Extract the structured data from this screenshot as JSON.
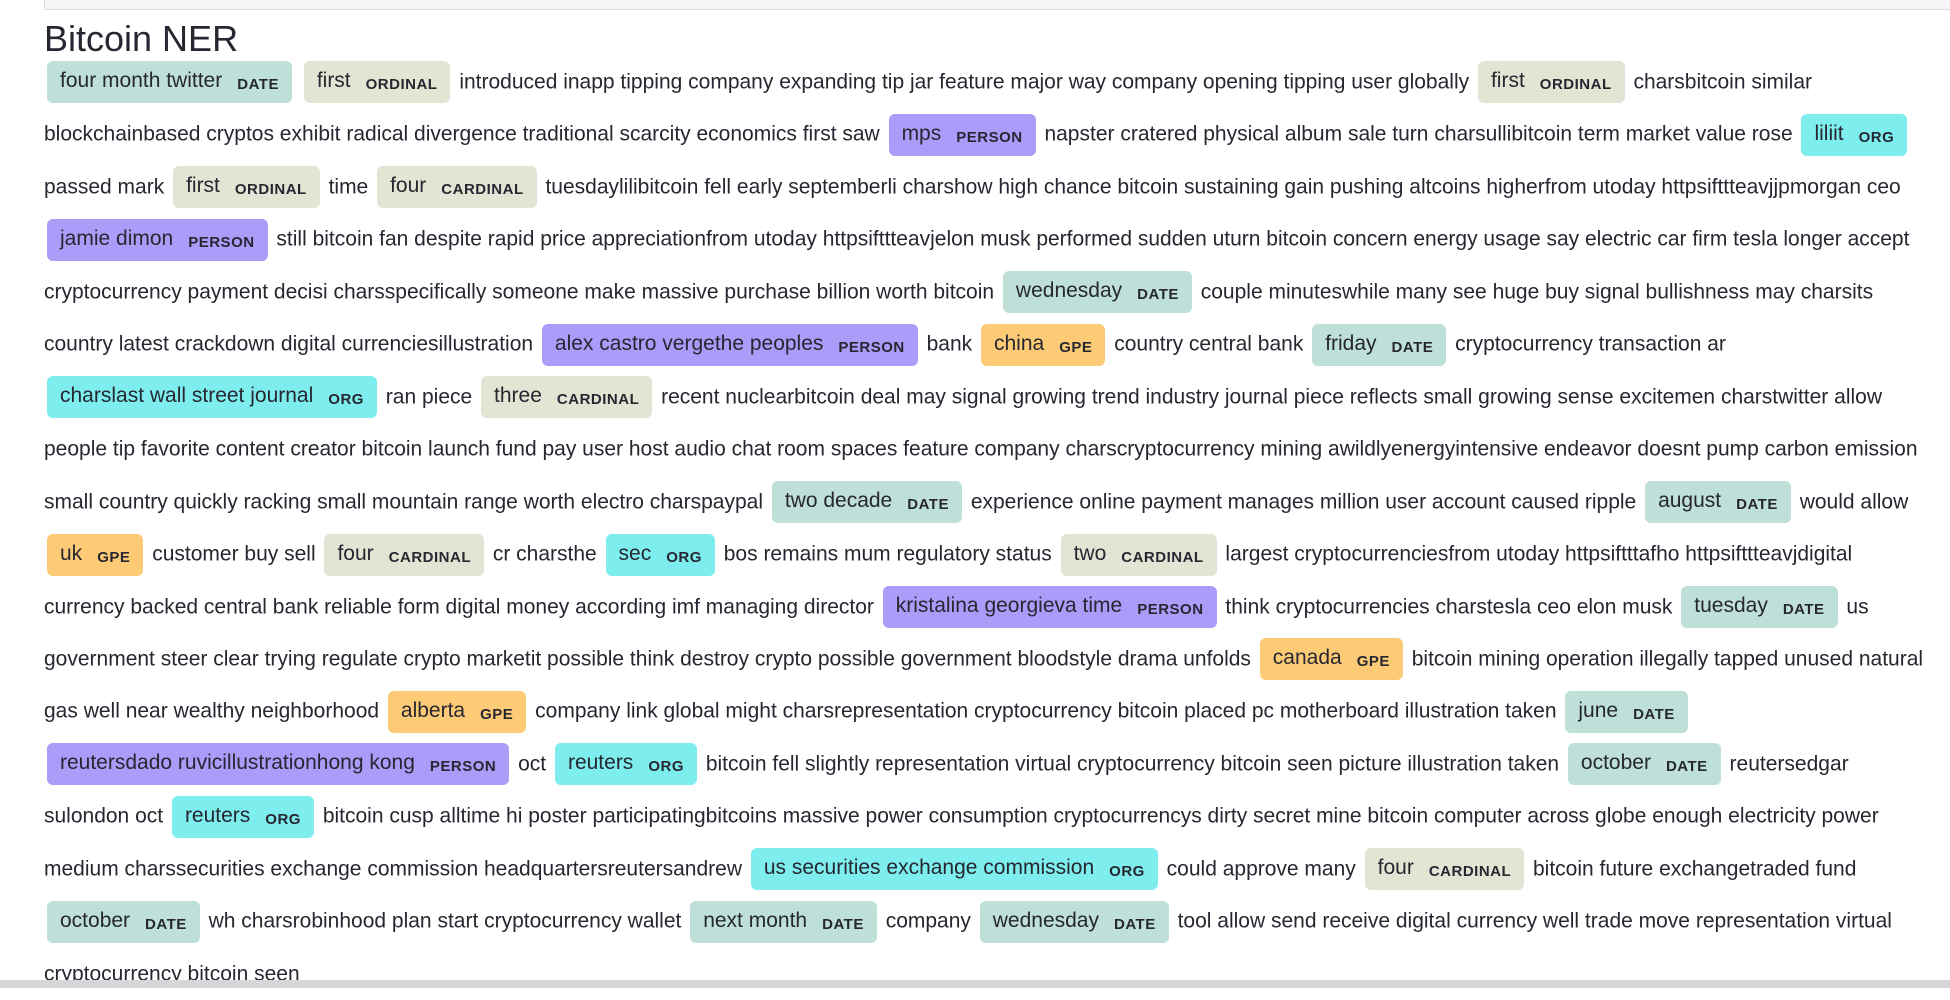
{
  "app": {
    "title": "Bitcoin NER"
  },
  "colors": {
    "DATE": "#bfe0d8",
    "ORDINAL": "#e2e5d4",
    "CARDINAL": "#e2e5d4",
    "PERSON": "#aa9cf9",
    "ORG": "#7deded",
    "GPE": "#fdcb76",
    "text": "#262730"
  },
  "ner": {
    "tokens": [
      {
        "label": "DATE",
        "text": "four month twitter"
      },
      {
        "label": "ORDINAL",
        "text": "first"
      },
      {
        "text": "introduced inapp tipping company expanding tip jar feature major way company opening tipping user globally"
      },
      {
        "label": "ORDINAL",
        "text": "first"
      },
      {
        "text": "charsbitcoin similar blockchainbased cryptos exhibit radical divergence traditional scarcity economics first saw"
      },
      {
        "label": "PERSON",
        "text": "mps"
      },
      {
        "text": "napster cratered physical album sale turn charsullibitcoin term market value rose"
      },
      {
        "label": "ORG",
        "text": "liliit"
      },
      {
        "text": "passed mark"
      },
      {
        "label": "ORDINAL",
        "text": "first"
      },
      {
        "text": "time"
      },
      {
        "label": "CARDINAL",
        "text": "four"
      },
      {
        "text": "tuesdaylilibitcoin fell early septemberli charshow high chance bitcoin sustaining gain pushing altcoins higherfrom utoday httpsifttteavjjpmorgan ceo"
      },
      {
        "label": "PERSON",
        "text": "jamie dimon"
      },
      {
        "text": "still bitcoin fan despite rapid price appreciationfrom utoday httpsifttteavjelon musk performed sudden uturn bitcoin concern energy usage say electric car firm tesla longer accept cryptocurrency payment decisi charsspecifically someone make massive purchase billion worth bitcoin"
      },
      {
        "label": "DATE",
        "text": "wednesday"
      },
      {
        "text": "couple minuteswhile many see huge buy signal bullishness may charsits country latest crackdown digital currenciesillustration"
      },
      {
        "label": "PERSON",
        "text": "alex castro vergethe peoples"
      },
      {
        "text": "bank"
      },
      {
        "label": "GPE",
        "text": "china"
      },
      {
        "text": "country central bank"
      },
      {
        "label": "DATE",
        "text": "friday"
      },
      {
        "text": "cryptocurrency transaction ar"
      },
      {
        "label": "ORG",
        "text": "charslast wall street journal"
      },
      {
        "text": "ran piece"
      },
      {
        "label": "CARDINAL",
        "text": "three"
      },
      {
        "text": "recent nuclearbitcoin deal may signal growing trend industry journal piece reflects small growing sense excitemen charstwitter allow people tip favorite content creator bitcoin launch fund pay user host audio chat room spaces feature company charscryptocurrency mining awildlyenergyintensive endeavor doesnt pump carbon emission small country quickly racking small mountain range worth electro charspaypal"
      },
      {
        "label": "DATE",
        "text": "two decade"
      },
      {
        "text": "experience online payment manages million user account caused ripple"
      },
      {
        "label": "DATE",
        "text": "august"
      },
      {
        "text": "would allow"
      },
      {
        "label": "GPE",
        "text": "uk"
      },
      {
        "text": "customer buy sell"
      },
      {
        "label": "CARDINAL",
        "text": "four"
      },
      {
        "text": "cr charsthe"
      },
      {
        "label": "ORG",
        "text": "sec"
      },
      {
        "text": "bos remains mum regulatory status"
      },
      {
        "label": "CARDINAL",
        "text": "two",
        "split": true
      },
      {
        "text": "largest cryptocurrenciesfrom utoday httpsiftttafho httpsifttteavjdigital currency backed central bank reliable form digital money according imf managing director"
      },
      {
        "label": "PERSON",
        "text": "kristalina georgieva time",
        "split": true
      },
      {
        "text": "think cryptocurrencies charstesla ceo elon musk"
      },
      {
        "label": "DATE",
        "text": "tuesday"
      },
      {
        "text": "us government steer clear trying regulate crypto marketit possible think destroy crypto possible government bloodstyle drama unfolds"
      },
      {
        "label": "GPE",
        "text": "canada"
      },
      {
        "text": "bitcoin mining operation illegally tapped unused natural gas well near wealthy neighborhood"
      },
      {
        "label": "GPE",
        "text": "alberta"
      },
      {
        "text": "company link global might charsrepresentation cryptocurrency bitcoin placed pc motherboard illustration taken"
      },
      {
        "label": "DATE",
        "text": "june"
      },
      {
        "label": "PERSON",
        "text": "reutersdado ruvicillustrationhong kong"
      },
      {
        "text": "oct"
      },
      {
        "label": "ORG",
        "text": "reuters"
      },
      {
        "text": "bitcoin fell slightly representation virtual cryptocurrency bitcoin seen picture illustration taken"
      },
      {
        "label": "DATE",
        "text": "october"
      },
      {
        "text": "reutersedgar sulondon oct"
      },
      {
        "label": "ORG",
        "text": "reuters"
      },
      {
        "text": "bitcoin cusp alltime hi poster participatingbitcoins massive power consumption cryptocurrencys dirty secret mine bitcoin computer across globe enough electricity power medium charssecurities exchange commission headquartersreutersandrew"
      },
      {
        "label": "ORG",
        "text": "us securities exchange commission"
      },
      {
        "text": "could approve many"
      },
      {
        "label": "CARDINAL",
        "text": "four"
      },
      {
        "text": "bitcoin future exchangetraded fund"
      },
      {
        "label": "DATE",
        "text": "october"
      },
      {
        "text": "wh charsrobinhood plan start cryptocurrency wallet"
      },
      {
        "label": "DATE",
        "text": "next month"
      },
      {
        "text": "company"
      },
      {
        "label": "DATE",
        "text": "wednesday"
      },
      {
        "text": "tool allow send receive digital currency well trade move representation virtual cryptocurrency bitcoin seen"
      }
    ]
  }
}
